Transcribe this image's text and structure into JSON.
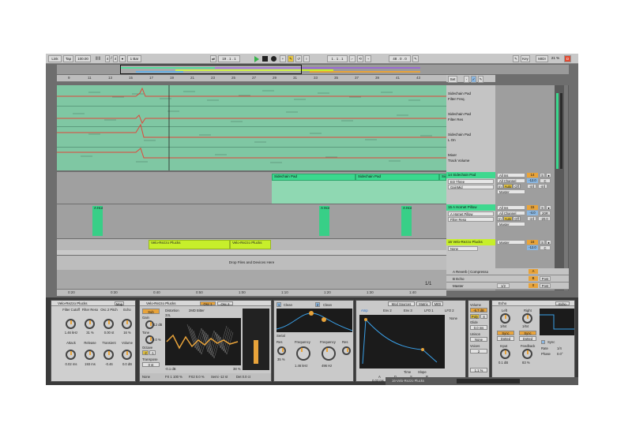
{
  "topbar": {
    "link": "Link",
    "tap": "Tap",
    "tempo": "100.00",
    "time_sig_num": "4",
    "time_sig_sep": "/",
    "time_sig_den": "4",
    "quantize": "1 Bar",
    "position": "19 .  1 .  1",
    "loop_start": "1 .  1 .  1",
    "loop_len": "48 .  0 .  0",
    "key": "Key",
    "midi": "MIDI",
    "cpu": "21 %",
    "disk": "D"
  },
  "ruler": {
    "bars": [
      "9",
      "11",
      "13",
      "15",
      "17",
      "19",
      "21",
      "23",
      "25",
      "27",
      "29",
      "31",
      "33",
      "35",
      "37",
      "39",
      "41",
      "43"
    ],
    "time": [
      "0:20",
      "0:30",
      "0:40",
      "0:50",
      "1:00",
      "1:10",
      "1:20",
      "1:30",
      "1:40"
    ],
    "page": "1/1",
    "set": "Set"
  },
  "automation": {
    "lanes": [
      {
        "device": "Sidechain Pad",
        "param": "Filter Freq."
      },
      {
        "device": "Sidechain Pad",
        "param": "Filter Res"
      },
      {
        "device": "Sidechain Pad",
        "param": "L On"
      },
      {
        "device": "Mixer",
        "param": "Track Volume"
      }
    ]
  },
  "tracks": [
    {
      "name": "14 Sidechain Pad",
      "clips": [
        "Sidechain Pad",
        "Sidechain Pad",
        "Sidechain Pad"
      ],
      "input": "All Ins",
      "device": "EQ Three",
      "channel": "All Channel",
      "param": "GainMid",
      "monitor_in": "In",
      "monitor_auto": "Auto",
      "monitor_off": "Off",
      "output": "Master",
      "num": "14",
      "vol": "-12.0",
      "pan": "C",
      "send_a": "-inf",
      "send_b": "-inf"
    },
    {
      "name": "15 A Hornet Pillow",
      "clips": [
        "A Hor",
        "A Hor",
        "A Hor"
      ],
      "input": "All Ins",
      "device": "A Hornet Pillow",
      "channel": "All Channel",
      "param": "Filter Reso",
      "monitor_in": "In",
      "monitor_auto": "Auto",
      "monitor_off": "Off",
      "output": "Master",
      "num": "15",
      "vol": "-4.0",
      "pan": "20R",
      "send_a": "-inf",
      "send_b": "-20.0"
    },
    {
      "name": "16 Velo-Rezzo Plucks",
      "clips": [
        "Velo-Rezzo Plucks",
        "Velo-Rezzo Plucks"
      ],
      "input": "None",
      "output": "Master",
      "num": "16",
      "vol": "-12.0",
      "pan": "C"
    }
  ],
  "dropzone": "Drop Files and Devices Here",
  "returns": [
    {
      "name": "A Reverb | Compresso",
      "num": "A"
    },
    {
      "name": "B Echo",
      "num": "B",
      "post": "Post"
    },
    {
      "name": "Master",
      "num": "0",
      "sel": "1/2",
      "post": "Post"
    }
  ],
  "device_chain": {
    "rack": {
      "title": "Velo-Rezzo Plucks",
      "map": "Map",
      "macros": [
        {
          "label": "Filter Cutoff",
          "value": "1.46 kHz"
        },
        {
          "label": "Filter Reso",
          "value": "31 %"
        },
        {
          "label": "Osc 2 Pitch",
          "value": "0.00 st"
        },
        {
          "label": "Echo",
          "value": "16 %"
        },
        {
          "label": "Attack",
          "value": "0.02 ms"
        },
        {
          "label": "Release",
          "value": "193 ms"
        },
        {
          "label": "Transient",
          "value": "-0.46"
        },
        {
          "label": "Volume",
          "value": "0.0 dB"
        }
      ]
    },
    "synth": {
      "title": "Velo-Rezzo Plucks",
      "osc1": "Osc 1",
      "osc2": "Osc 2",
      "sub": "Sub",
      "gain_label": "Gain",
      "gain": "-12 dB",
      "tone_label": "Tone",
      "tone": "0.0 %",
      "octave_label": "Octave",
      "octave_opts": [
        "-2",
        "-1"
      ],
      "transpose_label": "Transpose",
      "transpose": "0 st",
      "osc_mode": "Distortion",
      "osc_shape": "2MD Bitter",
      "osc_val": "33L",
      "osc_db": "-0.1 dB",
      "osc_pct": "38 %",
      "footer": [
        "None",
        "FX 1 100 %",
        "FX2 0.0 %",
        "Semi -12 st",
        "Det 0.0 ct"
      ]
    },
    "filter": {
      "f1": "Clean",
      "f2": "Clean",
      "serial": "Serial",
      "res_label": "Res",
      "res": "35 %",
      "freq_label": "Frequency",
      "freq": "1.46 kHz",
      "freq2_label": "Frequency",
      "freq2": "496 Hz",
      "res2_label": "Res"
    },
    "mod": {
      "tabs": [
        "Mod Sources",
        "Matrix",
        "MIDI"
      ],
      "env_tabs": [
        "Amp",
        "Env 2",
        "Env 3",
        "LFO 1",
        "LFO 2"
      ],
      "mode": "None",
      "time": "Time",
      "slope": "Slope",
      "adsr_labels": [
        "A",
        "D",
        "S",
        "R"
      ],
      "adsr": [
        "0.02 ms",
        "142 ms",
        "-18 dB",
        "162 ms"
      ]
    },
    "global": {
      "volume_label": "Volume",
      "volume": "-6.7 dB",
      "poly": "Poly",
      "poly_n": "8",
      "glide_label": "Glide",
      "glide": "0.0 ms",
      "unison_label": "Unison",
      "unison": "None",
      "voices_label": "Voices",
      "voices": "2",
      "amount": "1.1 %"
    },
    "echo": {
      "title": "Echo",
      "tab": "Echo",
      "left_label": "Left",
      "left": "1/64",
      "right_label": "Right",
      "right": "1/64",
      "sync": "Sync",
      "mode": "Dotted",
      "input_label": "Input",
      "input": "0.1 dB",
      "feedback_label": "Feedback",
      "feedback": "83 %",
      "sync_label": "Sync",
      "rate_label": "Rate",
      "rate": "1/4",
      "phase_label": "Phase",
      "phase": "0.0°"
    }
  },
  "status": {
    "track": "16-Velo-Rezzo Plucks"
  },
  "colors": {
    "automation_bg": "#7fc7a3",
    "clip_green": "#3bd88e",
    "clip_lime": "#c7ef2b",
    "accent": "#e8a33a",
    "automation_line": "#e0463a"
  }
}
